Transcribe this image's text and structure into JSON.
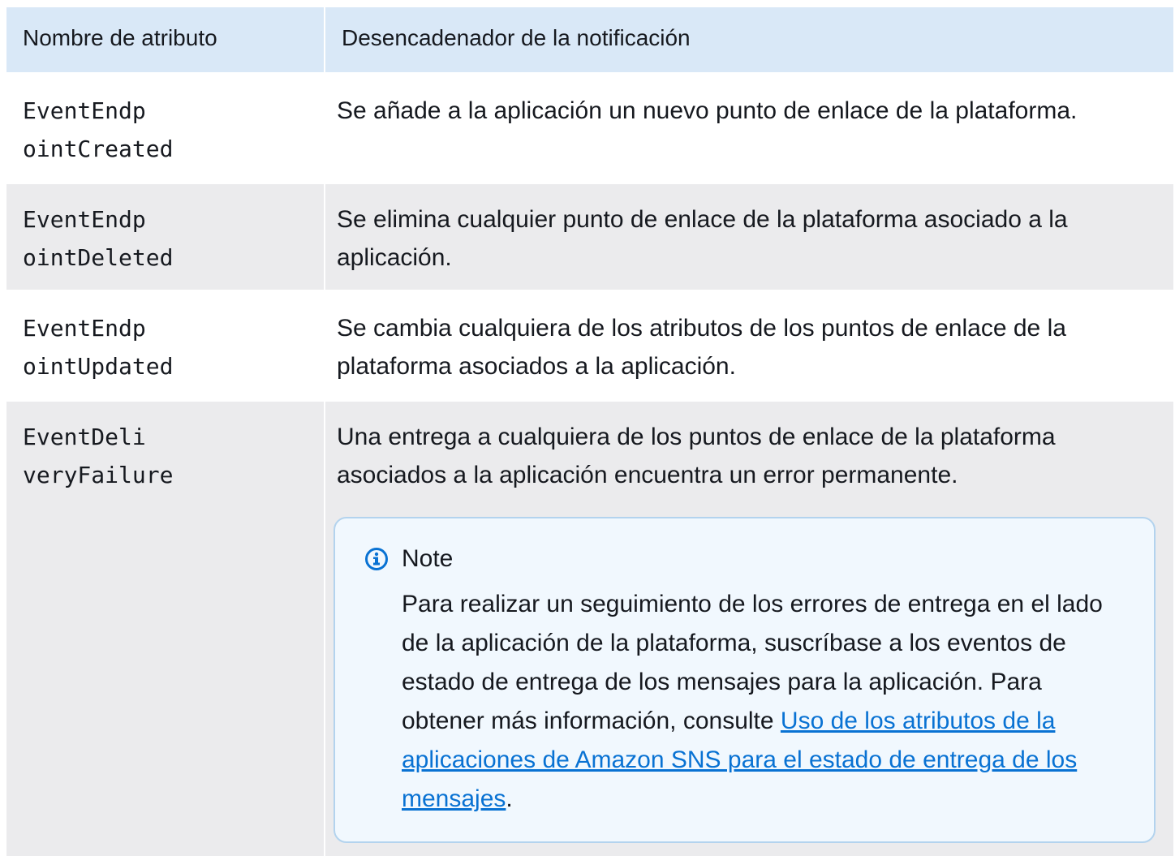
{
  "table": {
    "header": {
      "col1": "Nombre de atributo",
      "col2": "Desencadenador de la notificación"
    },
    "rows": [
      {
        "attribute": "EventEndp\nointCreated",
        "trigger": "Se añade a la aplicación un nuevo punto de enlace de la plataforma."
      },
      {
        "attribute": "EventEndp\nointDeleted",
        "trigger": "Se elimina cualquier punto de enlace de la plataforma asociado a la aplicación."
      },
      {
        "attribute": "EventEndp\nointUpdated",
        "trigger": "Se cambia cualquiera de los atributos de los puntos de enlace de la plataforma asociados a la aplicación."
      },
      {
        "attribute": "EventDeli\nveryFailure",
        "trigger": "Una entrega a cualquiera de los puntos de enlace de la plataforma asociados a la aplicación encuentra un error permanente.",
        "note": {
          "title": "Note",
          "icon": "info-icon",
          "text": "Para realizar un seguimiento de los errores de entrega en el lado de la aplicación de la plataforma, suscríbase a los eventos de estado de entrega de los mensajes para la aplicación. Para obtener más información, consulte ",
          "link_text": "Uso de los atributos de la aplicaciones de Amazon SNS para el estado de entrega de los mensajes",
          "after_link": "."
        }
      }
    ]
  },
  "colors": {
    "header_bg": "#d9e8f7",
    "alt_row_bg": "#ebebed",
    "note_bg": "#f1f8fe",
    "note_border": "#b3d3ee",
    "link": "#0972d3",
    "icon": "#0972d3"
  }
}
